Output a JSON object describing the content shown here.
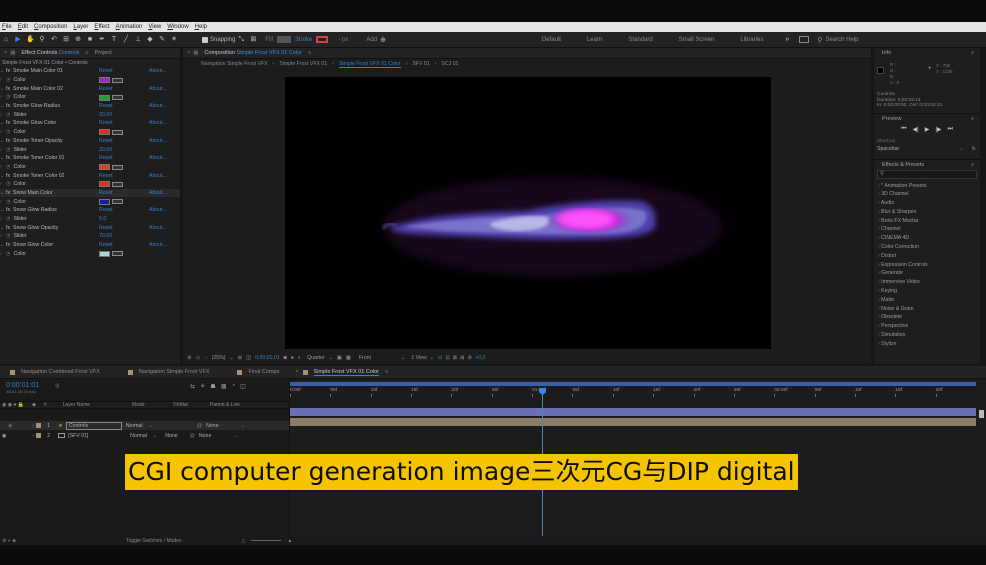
{
  "menu": [
    "File",
    "Edit",
    "Composition",
    "Layer",
    "Effect",
    "Animation",
    "View",
    "Window",
    "Help"
  ],
  "toolbar": {
    "snapping_label": "Snapping",
    "fill_label": "Fill",
    "stroke_label": "Stroke",
    "stroke_px": "- px",
    "add_label": "Add",
    "workspaces": [
      "Default",
      "Learn",
      "Standard",
      "Small Screen",
      "Libraries"
    ],
    "search_placeholder": "Search Help"
  },
  "left_panel": {
    "tab_effect_controls": "Effect Controls",
    "tab_effect_target": "Controls",
    "tab_project": "Project",
    "subtitle": "Simple Frost VFX 01 Color • Controls",
    "reset": "Reset",
    "about": "About...",
    "effects": [
      {
        "name": "Smoke Main Color 01",
        "param": "Color",
        "kind": "color",
        "color": "#a01fd0"
      },
      {
        "name": "Smoke Main Color 02",
        "param": "Color",
        "kind": "color",
        "color": "#1fa03a"
      },
      {
        "name": "Smoke Glow Radius",
        "param": "Slider",
        "kind": "slider",
        "value": "20,00"
      },
      {
        "name": "Smoke Glow Color",
        "param": "Color",
        "kind": "color",
        "color": "#e0301a"
      },
      {
        "name": "Smoke Toner Opacity",
        "param": "Slider",
        "kind": "slider",
        "value": "20,00"
      },
      {
        "name": "Smoke Toner Color 01",
        "param": "Color",
        "kind": "color",
        "color": "#e04018"
      },
      {
        "name": "Smoke Toner Color 02",
        "param": "Color",
        "kind": "color",
        "color": "#e0301a"
      },
      {
        "name": "Snow Main Color",
        "param": "Color",
        "kind": "color",
        "color": "#1a1aa0"
      },
      {
        "name": "Snow Glow Radius",
        "param": "Slider",
        "kind": "slider",
        "value": "5,0"
      },
      {
        "name": "Snow Glow Opacity",
        "param": "Slider",
        "kind": "slider",
        "value": "70,00"
      },
      {
        "name": "Snow Glow Color",
        "param": "Color",
        "kind": "color",
        "color": "#a8d8d0"
      }
    ]
  },
  "composition": {
    "tab_label": "Composition",
    "tab_name": "Simple Frost VFX 01 Color",
    "breadcrumbs": [
      "Navigation Simple Frost VFX",
      "Simple Frost VFX 01",
      "Simple Frost VFX 01 Color",
      "SFV 01",
      "SCJ 01"
    ],
    "footer": {
      "zoom": "(25%)",
      "timecode": "0;00;01;01",
      "quality": "Quarter",
      "camera": "Front",
      "views": "1 View",
      "exposure": "+0,0"
    }
  },
  "info_panel": {
    "title": "Info",
    "r": "R :",
    "g": "G :",
    "b": "B :",
    "a": "A :  0",
    "x": "X : 706",
    "y": "Y : 1236",
    "controls_label": "Controls",
    "duration": "Duration: 0;00:03:13",
    "in_out": "In: 0;00:00:00, Out: 0;00:03:13"
  },
  "preview_panel": {
    "title": "Preview",
    "shortcut_label": "Shortcut",
    "shortcut_value": "Spacebar"
  },
  "effects_presets": {
    "title": "Effects & Presets",
    "search_placeholder": "",
    "items": [
      "* Animation Presets",
      "3D Channel",
      "Audio",
      "Blur & Sharpen",
      "Boris FX Mocha",
      "Channel",
      "CINEMA 4D",
      "Color Correction",
      "Distort",
      "Expression Controls",
      "Generate",
      "Immersive Video",
      "Keying",
      "Matte",
      "Noise & Grain",
      "Obsolete",
      "Perspective",
      "Simulation",
      "Stylize"
    ]
  },
  "timeline": {
    "tabs": [
      "Navigation Combined Frost VFX",
      "Navigation Simple Frost VFX",
      "Final Comps",
      "Simple Frost VFX 01 Color"
    ],
    "current_time": "0:00:01:01",
    "fps": "00031 (30.00 fps)",
    "col_headers": {
      "source": "Layer Name",
      "mode": "Mode",
      "trkmat": "TrkMat",
      "parent": "Parent & Link"
    },
    "layers": [
      {
        "num": "1",
        "name": "Controls",
        "mode": "Normal",
        "trkmat": "",
        "parent": "None"
      },
      {
        "num": "2",
        "name": "[SFV 01]",
        "mode": "Normal",
        "trkmat": "None",
        "parent": "None"
      }
    ],
    "ruler": [
      "0:00f",
      "05f",
      "10f",
      "15f",
      "20f",
      "25f",
      "01:00f",
      "05f",
      "10f",
      "15f",
      "20f",
      "25f",
      "02:00f",
      "05f",
      "10f",
      "15f",
      "20f"
    ],
    "footer_toggle": "Toggle Switches / Modes"
  },
  "caption": "CGI computer generation image三次元CG与DIP digital",
  "colors": {
    "accent": "#2d8ceb",
    "caption_bg": "#f5c400",
    "layer1_bar": "#6a6fb8",
    "layer2_bar": "#8a7c68"
  }
}
